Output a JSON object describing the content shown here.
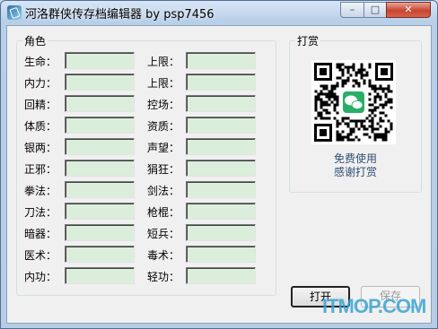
{
  "window": {
    "title": "河洛群侠传存档编辑器 by psp7456",
    "min_symbol": "–",
    "max_symbol": "□",
    "close_symbol": "✕"
  },
  "role_group": {
    "title": "角色",
    "left_fields": [
      {
        "label": "生命：",
        "value": ""
      },
      {
        "label": "内力：",
        "value": ""
      },
      {
        "label": "回精：",
        "value": ""
      },
      {
        "label": "体质：",
        "value": ""
      },
      {
        "label": "银两：",
        "value": ""
      },
      {
        "label": "正邪：",
        "value": ""
      },
      {
        "label": "拳法：",
        "value": ""
      },
      {
        "label": "刀法：",
        "value": ""
      },
      {
        "label": "暗器：",
        "value": ""
      },
      {
        "label": "医术：",
        "value": ""
      },
      {
        "label": "内功：",
        "value": ""
      }
    ],
    "right_fields": [
      {
        "label": "上限：",
        "value": ""
      },
      {
        "label": "上限：",
        "value": ""
      },
      {
        "label": "控场：",
        "value": ""
      },
      {
        "label": "资质：",
        "value": ""
      },
      {
        "label": "声望：",
        "value": ""
      },
      {
        "label": "狷狂：",
        "value": ""
      },
      {
        "label": "剑法：",
        "value": ""
      },
      {
        "label": "枪棍：",
        "value": ""
      },
      {
        "label": "短兵：",
        "value": ""
      },
      {
        "label": "毒术：",
        "value": ""
      },
      {
        "label": "轻功：",
        "value": ""
      }
    ]
  },
  "reward_group": {
    "title": "打赏",
    "line1": "免费使用",
    "line2": "感谢打赏",
    "qr_color": "#000000",
    "wechat_color": "#2aae67"
  },
  "buttons": {
    "open": "打开",
    "save": "保存"
  },
  "watermark": "ITMOP.COM"
}
